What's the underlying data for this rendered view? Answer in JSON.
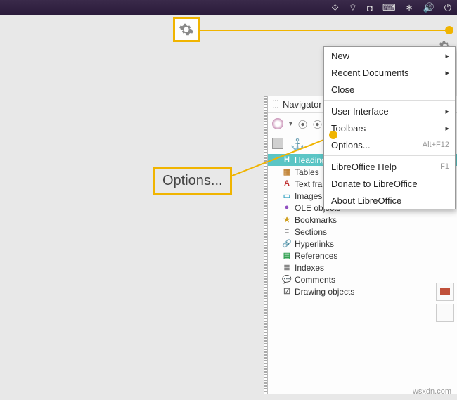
{
  "topbar_icons": [
    "dropbox",
    "wifi",
    "shield",
    "keyboard",
    "bluetooth",
    "volume",
    "power"
  ],
  "annotation_label": "Options...",
  "navigator": {
    "title": "Navigator",
    "items": [
      {
        "icon": "H",
        "label": "Headings",
        "color": "#2a7a4a",
        "selected": true
      },
      {
        "icon": "table",
        "label": "Tables",
        "color": "#c08030"
      },
      {
        "icon": "text",
        "label": "Text frames",
        "color": "#c03030"
      },
      {
        "icon": "image",
        "label": "Images",
        "color": "#30a0c0"
      },
      {
        "icon": "ole",
        "label": "OLE objects",
        "color": "#9050c0"
      },
      {
        "icon": "bookmark",
        "label": "Bookmarks",
        "color": "#d0a020"
      },
      {
        "icon": "section",
        "label": "Sections",
        "color": "#888"
      },
      {
        "icon": "link",
        "label": "Hyperlinks",
        "color": "#5080c0"
      },
      {
        "icon": "ref",
        "label": "References",
        "color": "#30a050"
      },
      {
        "icon": "index",
        "label": "Indexes",
        "color": "#888"
      },
      {
        "icon": "comment",
        "label": "Comments",
        "color": "#e0b020"
      },
      {
        "icon": "draw",
        "label": "Drawing objects",
        "color": "#666"
      }
    ]
  },
  "menu": {
    "groups": [
      [
        {
          "label": "New",
          "submenu": true
        },
        {
          "label": "Recent Documents",
          "submenu": true
        },
        {
          "label": "Close"
        }
      ],
      [
        {
          "label": "User Interface",
          "submenu": true
        },
        {
          "label": "Toolbars",
          "submenu": true
        },
        {
          "label": "Options...",
          "shortcut": "Alt+F12"
        }
      ],
      [
        {
          "label": "LibreOffice Help",
          "shortcut": "F1"
        },
        {
          "label": "Donate to LibreOffice"
        },
        {
          "label": "About LibreOffice"
        }
      ]
    ]
  },
  "watermark": "wsxdn.com"
}
